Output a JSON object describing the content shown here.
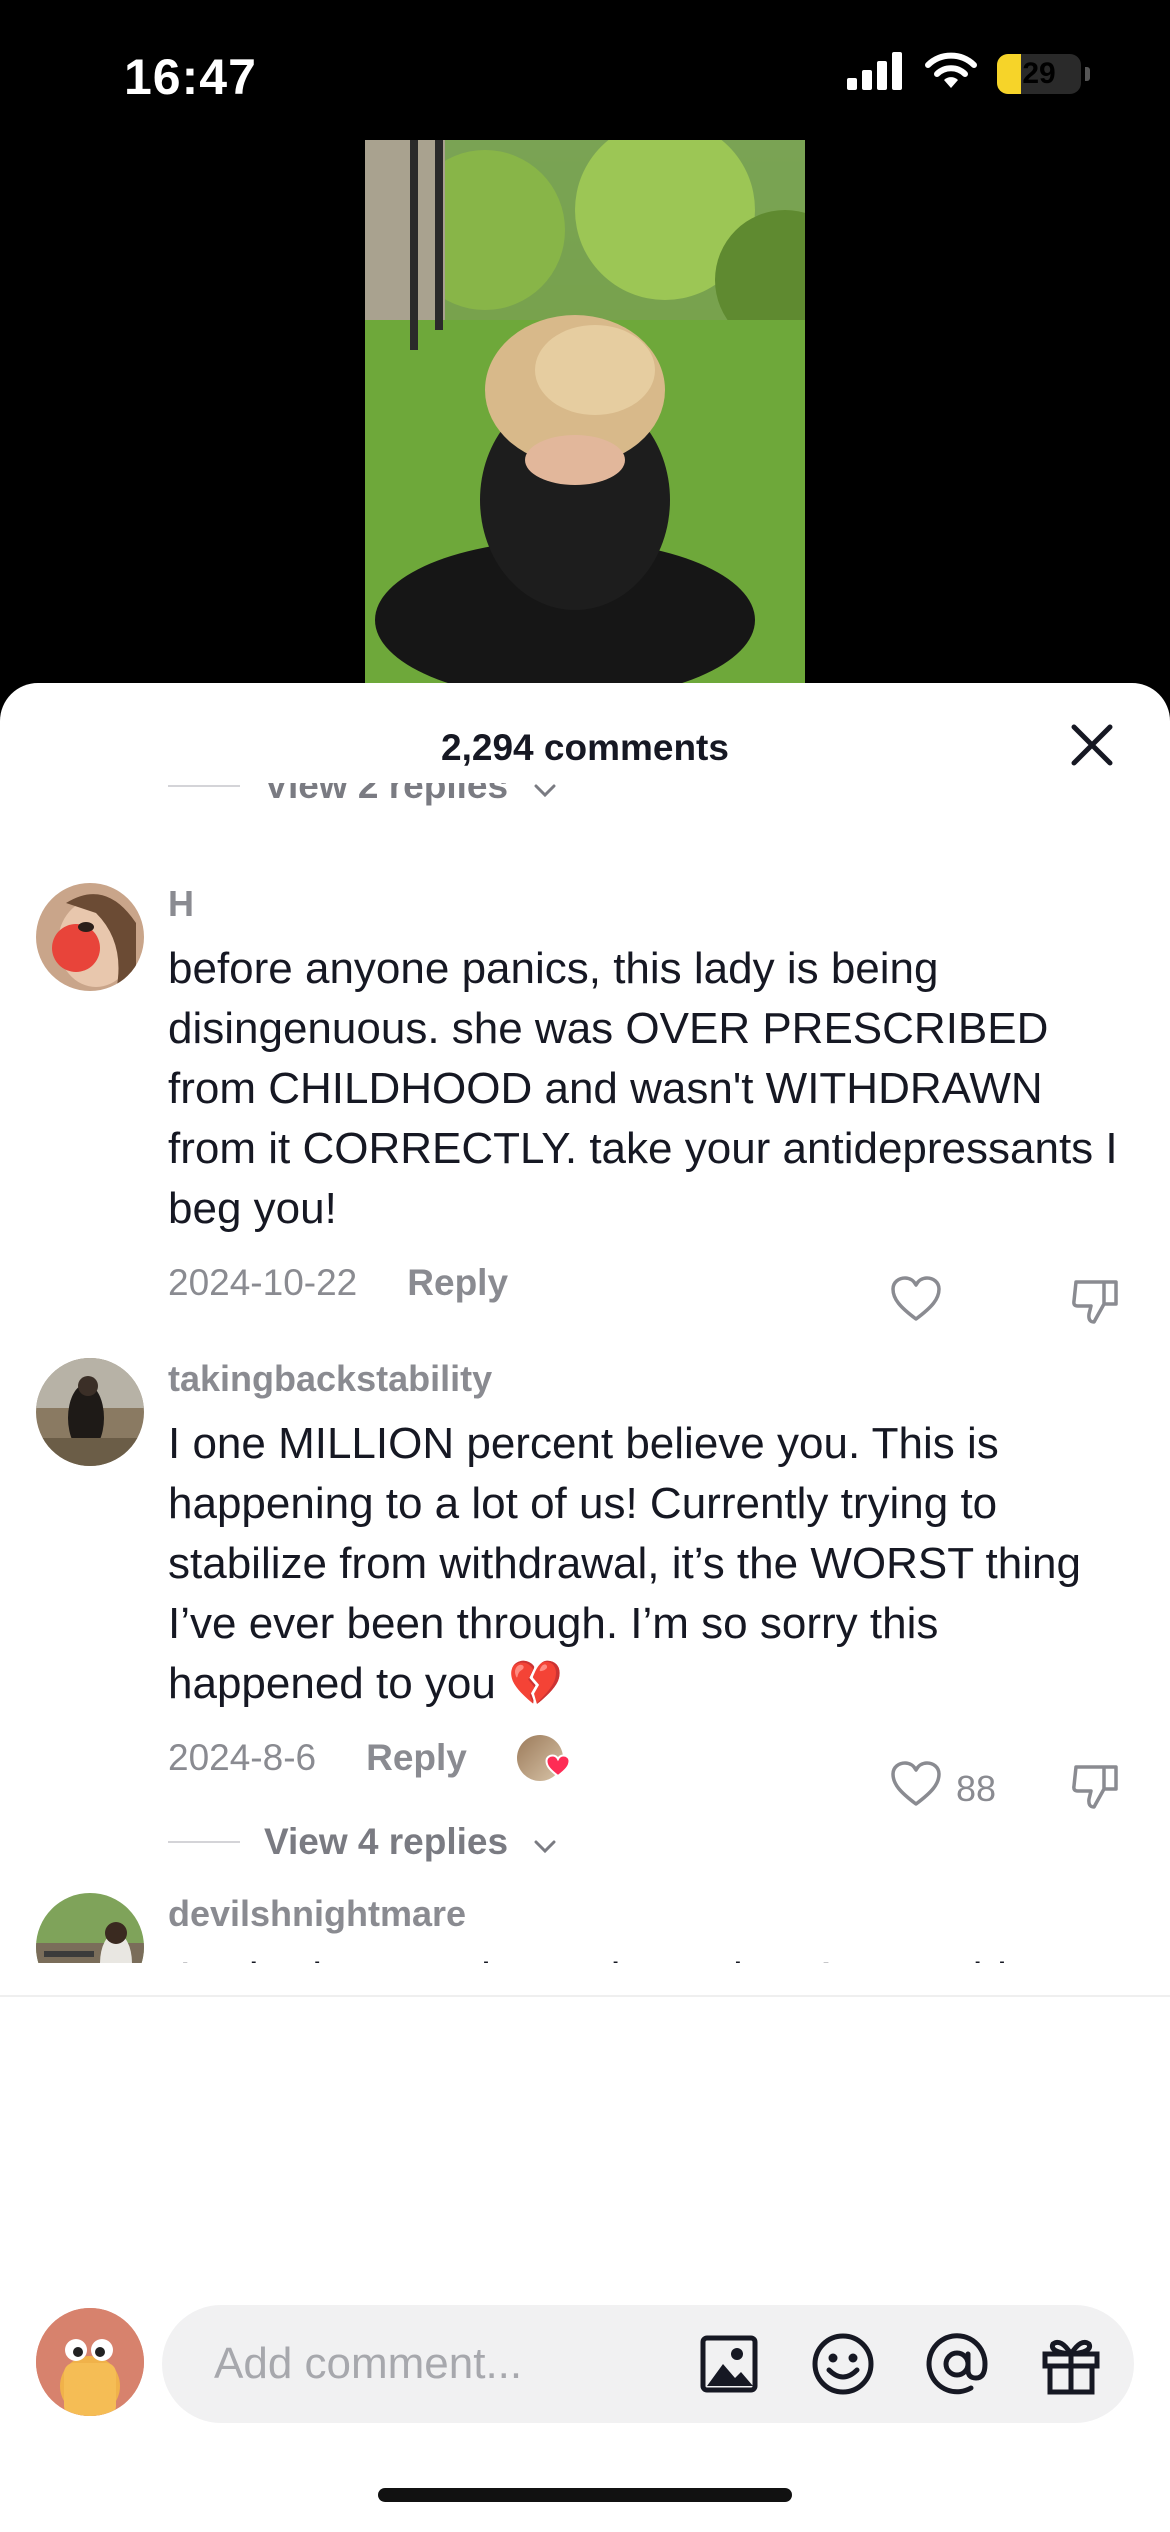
{
  "status_bar": {
    "time": "16:47",
    "battery_percent": "29",
    "battery_level": 0.29,
    "battery_color": "#f6d429"
  },
  "sheet": {
    "comment_count_label": "2,294 comments"
  },
  "replies_top": {
    "label": "View 2 replies"
  },
  "comments": [
    {
      "username": "H",
      "text": "before anyone panics, this lady is being disingenuous. she was OVER PRESCRIBED from CHILDHOOD and wasn't WITHDRAWN from it CORRECTLY. take your antidepressants I beg you!",
      "date": "2024-10-22",
      "reply_label": "Reply",
      "likes": ""
    },
    {
      "username": "takingbackstability",
      "text": "I one MILLION percent believe you. This is happening to a lot of us! Currently trying to stabilize from withdrawal, it’s the WORST thing I’ve ever been through. I’m so sorry this happened to you 💔",
      "date": "2024-8-6",
      "reply_label": "Reply",
      "likes": "88",
      "replies_label": "View 4 replies"
    },
    {
      "username": "devilshnightmare",
      "text": "I’ve had serotonin syndrome last August this year. I have severe panic and anxiety attacks. They put me on lorazepam. My body became dependent now I’m on clonazepam. It’s been seven or eight weeks and"
    }
  ],
  "input": {
    "placeholder": "Add comment..."
  },
  "icons": [
    "signal-icon",
    "wifi-icon",
    "battery-icon",
    "close-icon",
    "chevron-down-icon",
    "heart-icon",
    "dislike-icon",
    "image-icon",
    "emoji-icon",
    "mention-icon",
    "gift-icon"
  ],
  "colors": {
    "text": "#161823",
    "muted": "#8a8b91",
    "heart_red": "#fe2c55"
  }
}
